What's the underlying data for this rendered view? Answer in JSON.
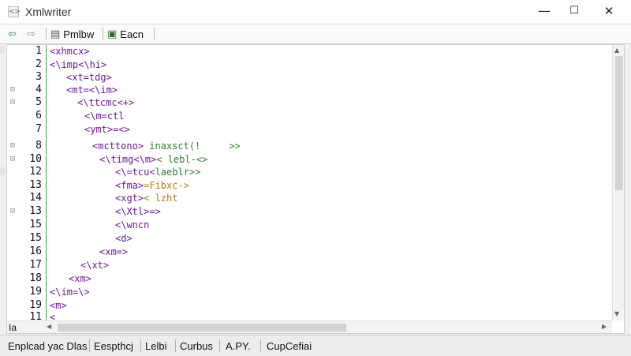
{
  "window": {
    "app_icon": "xml-icon",
    "title": "Xmlwriter",
    "minimize_glyph": "—",
    "maximize_glyph": "☐",
    "close_glyph": "✕"
  },
  "toolbar": {
    "back_icon": "back-icon",
    "forward_icon": "forward-icon",
    "items": [
      {
        "name": "pmlbw",
        "icon": "document-icon",
        "label": "Pmlbw"
      },
      {
        "name": "eacn",
        "icon": "monitor-icon",
        "label": "Eacn"
      }
    ]
  },
  "editor": {
    "line_numbers": [
      "1",
      "2",
      "3",
      "4",
      "5",
      "6",
      "7",
      "8",
      "10",
      "12",
      "13",
      "14",
      "13",
      "15",
      "15",
      "16",
      "17",
      "18",
      "19",
      "19",
      "11"
    ],
    "lines": [
      {
        "tag": "<xhmcx>",
        "rest": ""
      },
      {
        "tag": "<\\imp<\\hi>",
        "rest": ""
      },
      {
        "tag": "<xt=tdg>",
        "rest": ""
      },
      {
        "tag": "<mt=<\\im>",
        "rest": ""
      },
      {
        "tag": "<\\ttcmc<+>",
        "rest": ""
      },
      {
        "tag": "<\\m=ctl",
        "rest": ""
      },
      {
        "tag": "<ymt>=<>",
        "rest": ""
      },
      {
        "tag": "<mcttono>",
        "rest": " inaxsct(!     >>"
      },
      {
        "tag": "<\\timg<\\m>",
        "rest": "< lebl-<>"
      },
      {
        "tag": "<\\=tcu<",
        "rest": "laeblr>>"
      },
      {
        "tag": "<fma>",
        "rest": "=Fibxc->"
      },
      {
        "tag": "<xgt>",
        "rest": "< lzht"
      },
      {
        "tag": "<\\Xtl>=>",
        "rest": ""
      },
      {
        "tag": "<\\wncn",
        "rest": ""
      },
      {
        "tag": "<d>",
        "rest": ""
      },
      {
        "tag": "<xm=>",
        "rest": ""
      },
      {
        "tag": "<\\xt>",
        "rest": ""
      },
      {
        "tag": "<xm>",
        "rest": ""
      },
      {
        "tag": "<\\im=\\>",
        "rest": ""
      },
      {
        "tag": "<m>",
        "rest": ""
      },
      {
        "tag": "<",
        "rest": ""
      }
    ],
    "corner_label": "Ia"
  },
  "status": {
    "items": [
      "Enplcad yac Dlas",
      "Eespthcj",
      "Lelbi",
      "Curbus",
      "A.PY.",
      "CupCefiai"
    ]
  },
  "colors": {
    "tag": "#6a1b9a",
    "attr": "#2e7d32",
    "value": "#b07d12",
    "gutter_line": "#3aa83a"
  }
}
